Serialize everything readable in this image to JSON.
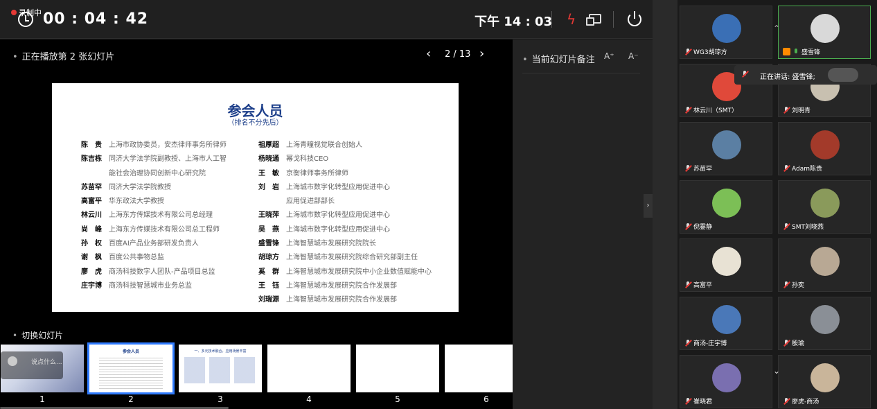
{
  "topbar": {
    "recording_label": "录制中",
    "timer": "00 : 04 : 42",
    "clock": "下午 14 : 03"
  },
  "slideshow": {
    "now_playing": "正在播放第 2 张幻灯片",
    "page_indicator": "2 / 13",
    "switch_label": "切换幻灯片",
    "thumbnails": [
      {
        "num": "1",
        "overlay_text": "说点什么..."
      },
      {
        "num": "2",
        "mini_title": "参会人员"
      },
      {
        "num": "3",
        "mini_title": "一、多元技术融合，应用场景丰富"
      },
      {
        "num": "4"
      },
      {
        "num": "5"
      },
      {
        "num": "6"
      }
    ],
    "selected_index": 2
  },
  "slide": {
    "title": "参会人员",
    "subtitle": "（排名不分先后）",
    "left": [
      {
        "name": "陈　贵",
        "desc": "上海市政协委员，安杰律师事务所律师"
      },
      {
        "name": "陈吉栋",
        "desc": "同济大学法学院副教授、上海市人工智"
      },
      {
        "name": "",
        "desc": "能社会治理协同创新中心研究院"
      },
      {
        "name": "苏苗罕",
        "desc": "同济大学法学院教授"
      },
      {
        "name": "高富平",
        "desc": "华东政法大学教授"
      },
      {
        "name": "林云川",
        "desc": "上海东方传媒技术有限公司总经理"
      },
      {
        "name": "尚　峰",
        "desc": "上海东方传媒技术有限公司总工程师"
      },
      {
        "name": "孙　权",
        "desc": "百度AI产品业务部研发负责人"
      },
      {
        "name": "谢　枫",
        "desc": "百度公共事物总监"
      },
      {
        "name": "廖　虎",
        "desc": "商汤科技数字人团队-产品项目总监"
      },
      {
        "name": "庄宇博",
        "desc": "商汤科技智慧城市业务总监"
      }
    ],
    "right": [
      {
        "name": "祖厚超",
        "desc": "上海青瞳视觉联合创始人"
      },
      {
        "name": "杨晓通",
        "desc": "幂戈科技CEO"
      },
      {
        "name": "王　敏",
        "desc": "京衡律师事务所律师"
      },
      {
        "name": "刘　岩",
        "desc": "上海城市数字化转型应用促进中心"
      },
      {
        "name": "",
        "desc": "应用促进部部长"
      },
      {
        "name": "王晓萍",
        "desc": "上海城市数字化转型应用促进中心"
      },
      {
        "name": "吴　燕",
        "desc": "上海城市数字化转型应用促进中心"
      },
      {
        "name": "盛雪锋",
        "desc": "上海智慧城市发展研究院院长"
      },
      {
        "name": "胡琼方",
        "desc": "上海智慧城市发展研究院综合研究部副主任"
      },
      {
        "name": "奚　群",
        "desc": "上海智慧城市发展研究院中小企业数值赋能中心"
      },
      {
        "name": "王　钰",
        "desc": "上海智慧城市发展研究院合作发展部"
      },
      {
        "name": "刘瑞源",
        "desc": "上海智慧城市发展研究院合作发展部"
      }
    ]
  },
  "notes": {
    "title": "当前幻灯片备注",
    "font_up": "A⁺",
    "font_down": "A⁻"
  },
  "speaking": {
    "text": "正在讲话: 盛雪锋;"
  },
  "participants": [
    {
      "name": "WG3胡琼方",
      "avatar_color": "#3a6fb5",
      "mic": "off"
    },
    {
      "name": "盛雪锋",
      "avatar_color": "#d9d9d9",
      "mic": "on",
      "host": true
    },
    {
      "name": "林云川（SMT）",
      "avatar_color": "#e0493a",
      "mic": "off"
    },
    {
      "name": "刘明青",
      "avatar_color": "#c8c0b0",
      "mic": "off"
    },
    {
      "name": "苏苗罕",
      "avatar_color": "#5b7fa3",
      "mic": "off"
    },
    {
      "name": "Adam陈贵",
      "avatar_color": "#a33a2a",
      "mic": "off"
    },
    {
      "name": "倪霎静",
      "avatar_color": "#7cbf56",
      "mic": "off"
    },
    {
      "name": "SMT刘晓燕",
      "avatar_color": "#8a9a5b",
      "mic": "off"
    },
    {
      "name": "高富平",
      "avatar_color": "#e8e2d4",
      "mic": "off"
    },
    {
      "name": "孙奕",
      "avatar_color": "#b8a894",
      "mic": "off"
    },
    {
      "name": "商汤-庄宇博",
      "avatar_color": "#4a78b8",
      "mic": "off"
    },
    {
      "name": "殷瑜",
      "avatar_color": "#8a8f96",
      "mic": "off"
    },
    {
      "name": "崔晓君",
      "avatar_color": "#7a6fb0",
      "mic": "off"
    },
    {
      "name": "廖虎-商汤",
      "avatar_color": "#c9b59a",
      "mic": "off"
    }
  ]
}
